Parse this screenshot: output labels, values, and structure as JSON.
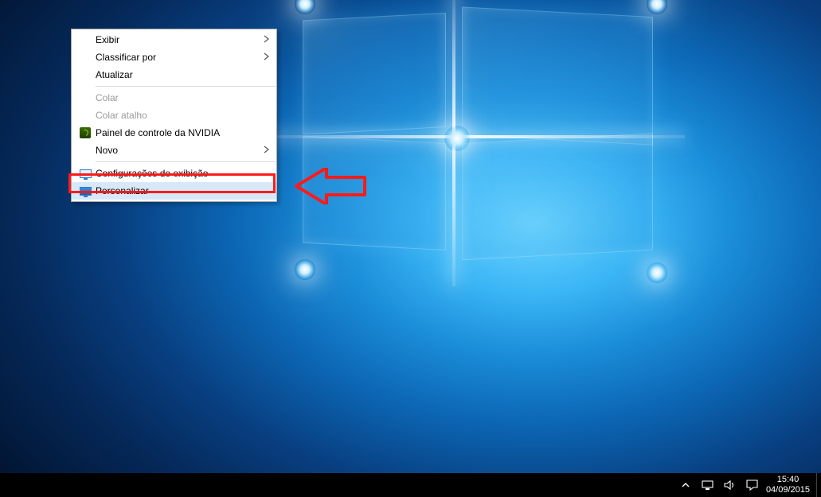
{
  "context_menu": {
    "items": [
      {
        "label": "Exibir",
        "has_submenu": true
      },
      {
        "label": "Classificar por",
        "has_submenu": true
      },
      {
        "label": "Atualizar"
      },
      {
        "sep": true
      },
      {
        "label": "Colar",
        "disabled": true
      },
      {
        "label": "Colar atalho",
        "disabled": true
      },
      {
        "label": "Painel de controle da NVIDIA",
        "icon": "nvidia-icon"
      },
      {
        "label": "Novo",
        "has_submenu": true
      },
      {
        "sep": true
      },
      {
        "label": "Configurações de exibição",
        "icon": "display-icon",
        "highlighted": true
      },
      {
        "label": "Personalizar",
        "icon": "personalize-icon"
      }
    ]
  },
  "taskbar": {
    "time": "15:40",
    "date": "04/09/2015"
  }
}
